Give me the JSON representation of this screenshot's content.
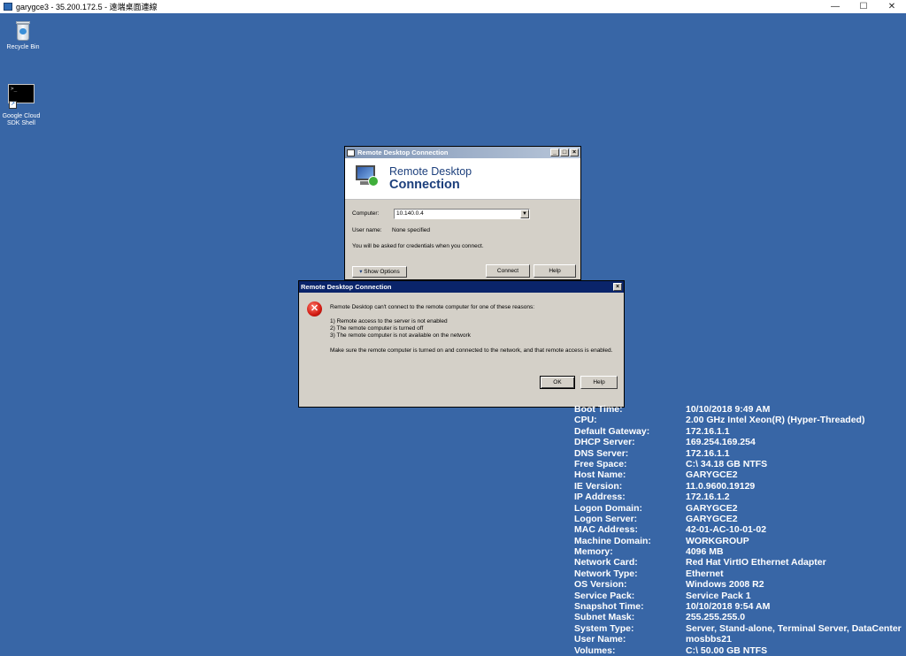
{
  "host_window": {
    "title": "garygce3 - 35.200.172.5 - 遠端桌面連線",
    "minimize": "—",
    "maximize": "☐",
    "close": "✕"
  },
  "desktop_icons": [
    {
      "label": "Recycle Bin",
      "icon": "recycle-bin-icon"
    },
    {
      "label": "Google Cloud SDK Shell",
      "icon": "terminal-icon"
    }
  ],
  "rdc_window": {
    "title": "Remote Desktop Connection",
    "banner_line1": "Remote Desktop",
    "banner_line2": "Connection",
    "computer_label": "Computer:",
    "computer_value": "10.140.0.4",
    "username_label": "User name:",
    "username_value": "None specified",
    "credentials_note": "You will be asked for credentials when you connect.",
    "show_options": "Show Options",
    "connect": "Connect",
    "help": "Help"
  },
  "error_dialog": {
    "title": "Remote Desktop Connection",
    "message": "Remote Desktop can't connect to the remote computer for one of these reasons:",
    "reasons": [
      "1) Remote access to the server is not enabled",
      "2) The remote computer is turned off",
      "3) The remote computer is not available on the network"
    ],
    "advice": "Make sure the remote computer is turned on and connected to the network, and that remote access is enabled.",
    "ok": "OK",
    "help": "Help"
  },
  "bginfo": [
    {
      "label": "Boot Time:",
      "value": "10/10/2018 9:49 AM"
    },
    {
      "label": "CPU:",
      "value": "2.00 GHz Intel Xeon(R) (Hyper-Threaded)"
    },
    {
      "label": "Default Gateway:",
      "value": "172.16.1.1"
    },
    {
      "label": "DHCP Server:",
      "value": "169.254.169.254"
    },
    {
      "label": "DNS Server:",
      "value": "172.16.1.1"
    },
    {
      "label": "Free Space:",
      "value": "C:\\ 34.18 GB NTFS"
    },
    {
      "label": "Host Name:",
      "value": "GARYGCE2"
    },
    {
      "label": "IE Version:",
      "value": "11.0.9600.19129"
    },
    {
      "label": "IP Address:",
      "value": "172.16.1.2"
    },
    {
      "label": "Logon Domain:",
      "value": "GARYGCE2"
    },
    {
      "label": "Logon Server:",
      "value": "GARYGCE2"
    },
    {
      "label": "MAC Address:",
      "value": "42-01-AC-10-01-02"
    },
    {
      "label": "Machine Domain:",
      "value": "WORKGROUP"
    },
    {
      "label": "Memory:",
      "value": "4096 MB"
    },
    {
      "label": "Network Card:",
      "value": "Red Hat VirtIO Ethernet Adapter"
    },
    {
      "label": "Network Type:",
      "value": "Ethernet"
    },
    {
      "label": "OS Version:",
      "value": "Windows 2008 R2"
    },
    {
      "label": "Service Pack:",
      "value": "Service Pack 1"
    },
    {
      "label": "Snapshot Time:",
      "value": "10/10/2018 9:54 AM"
    },
    {
      "label": "Subnet Mask:",
      "value": "255.255.255.0"
    },
    {
      "label": "System Type:",
      "value": "Server, Stand-alone, Terminal Server, DataCenter"
    },
    {
      "label": "User Name:",
      "value": "mosbbs21"
    },
    {
      "label": "Volumes:",
      "value": "C:\\ 50.00 GB NTFS"
    }
  ]
}
